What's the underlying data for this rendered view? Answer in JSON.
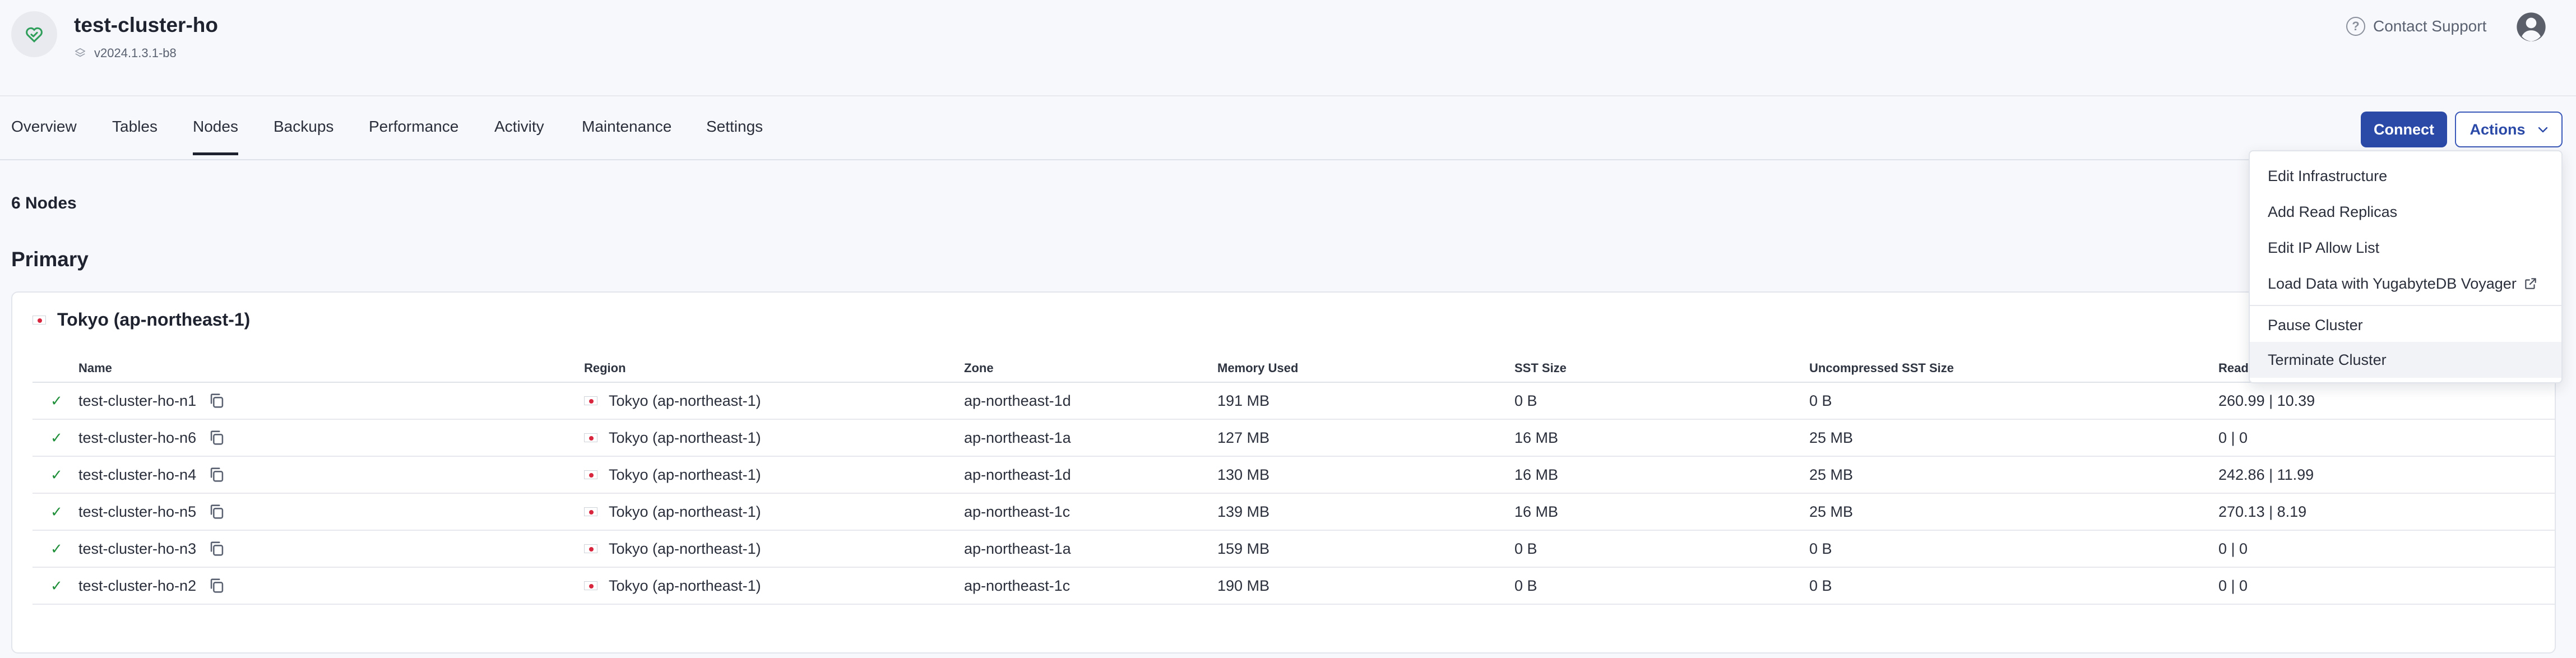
{
  "header": {
    "cluster_name": "test-cluster-ho",
    "version": "v2024.1.3.1-b8",
    "contact_support": "Contact Support",
    "help_icon_glyph": "?",
    "status_color": "#2f9e5a"
  },
  "tabs": [
    {
      "label": "Overview"
    },
    {
      "label": "Tables"
    },
    {
      "label": "Nodes",
      "active": true
    },
    {
      "label": "Backups"
    },
    {
      "label": "Performance"
    },
    {
      "label": "Activity"
    },
    {
      "label": "Maintenance"
    },
    {
      "label": "Settings"
    }
  ],
  "buttons": {
    "connect": "Connect",
    "actions": "Actions"
  },
  "nodes_count": "6 Nodes",
  "section_title": "Primary",
  "region_title": "Tokyo (ap-northeast-1)",
  "table": {
    "columns": [
      "Name",
      "Region",
      "Zone",
      "Memory Used",
      "SST Size",
      "Uncompressed SST Size",
      "Read"
    ],
    "rows": [
      {
        "name": "test-cluster-ho-n1",
        "region": "Tokyo (ap-northeast-1)",
        "zone": "ap-northeast-1d",
        "memory": "191 MB",
        "sst": "0 B",
        "usst": "0 B",
        "read": "260.99 | 10.39"
      },
      {
        "name": "test-cluster-ho-n6",
        "region": "Tokyo (ap-northeast-1)",
        "zone": "ap-northeast-1a",
        "memory": "127 MB",
        "sst": "16 MB",
        "usst": "25 MB",
        "read": "0 | 0"
      },
      {
        "name": "test-cluster-ho-n4",
        "region": "Tokyo (ap-northeast-1)",
        "zone": "ap-northeast-1d",
        "memory": "130 MB",
        "sst": "16 MB",
        "usst": "25 MB",
        "read": "242.86 | 11.99"
      },
      {
        "name": "test-cluster-ho-n5",
        "region": "Tokyo (ap-northeast-1)",
        "zone": "ap-northeast-1c",
        "memory": "139 MB",
        "sst": "16 MB",
        "usst": "25 MB",
        "read": "270.13 | 8.19"
      },
      {
        "name": "test-cluster-ho-n3",
        "region": "Tokyo (ap-northeast-1)",
        "zone": "ap-northeast-1a",
        "memory": "159 MB",
        "sst": "0 B",
        "usst": "0 B",
        "read": "0 | 0"
      },
      {
        "name": "test-cluster-ho-n2",
        "region": "Tokyo (ap-northeast-1)",
        "zone": "ap-northeast-1c",
        "memory": "190 MB",
        "sst": "0 B",
        "usst": "0 B",
        "read": "0 | 0"
      }
    ],
    "status_glyph": "✓",
    "status_color": "#1f8f3a"
  },
  "actions_menu": [
    {
      "label": "Edit Infrastructure"
    },
    {
      "label": "Add Read Replicas"
    },
    {
      "label": "Edit IP Allow List"
    },
    {
      "label": "Load Data with YugabyteDB Voyager",
      "external": true
    },
    {
      "label": "Pause Cluster"
    },
    {
      "label": "Terminate Cluster",
      "highlighted": true
    }
  ],
  "colors": {
    "primary": "#2b4aa8",
    "background": "#f7f8fb"
  }
}
